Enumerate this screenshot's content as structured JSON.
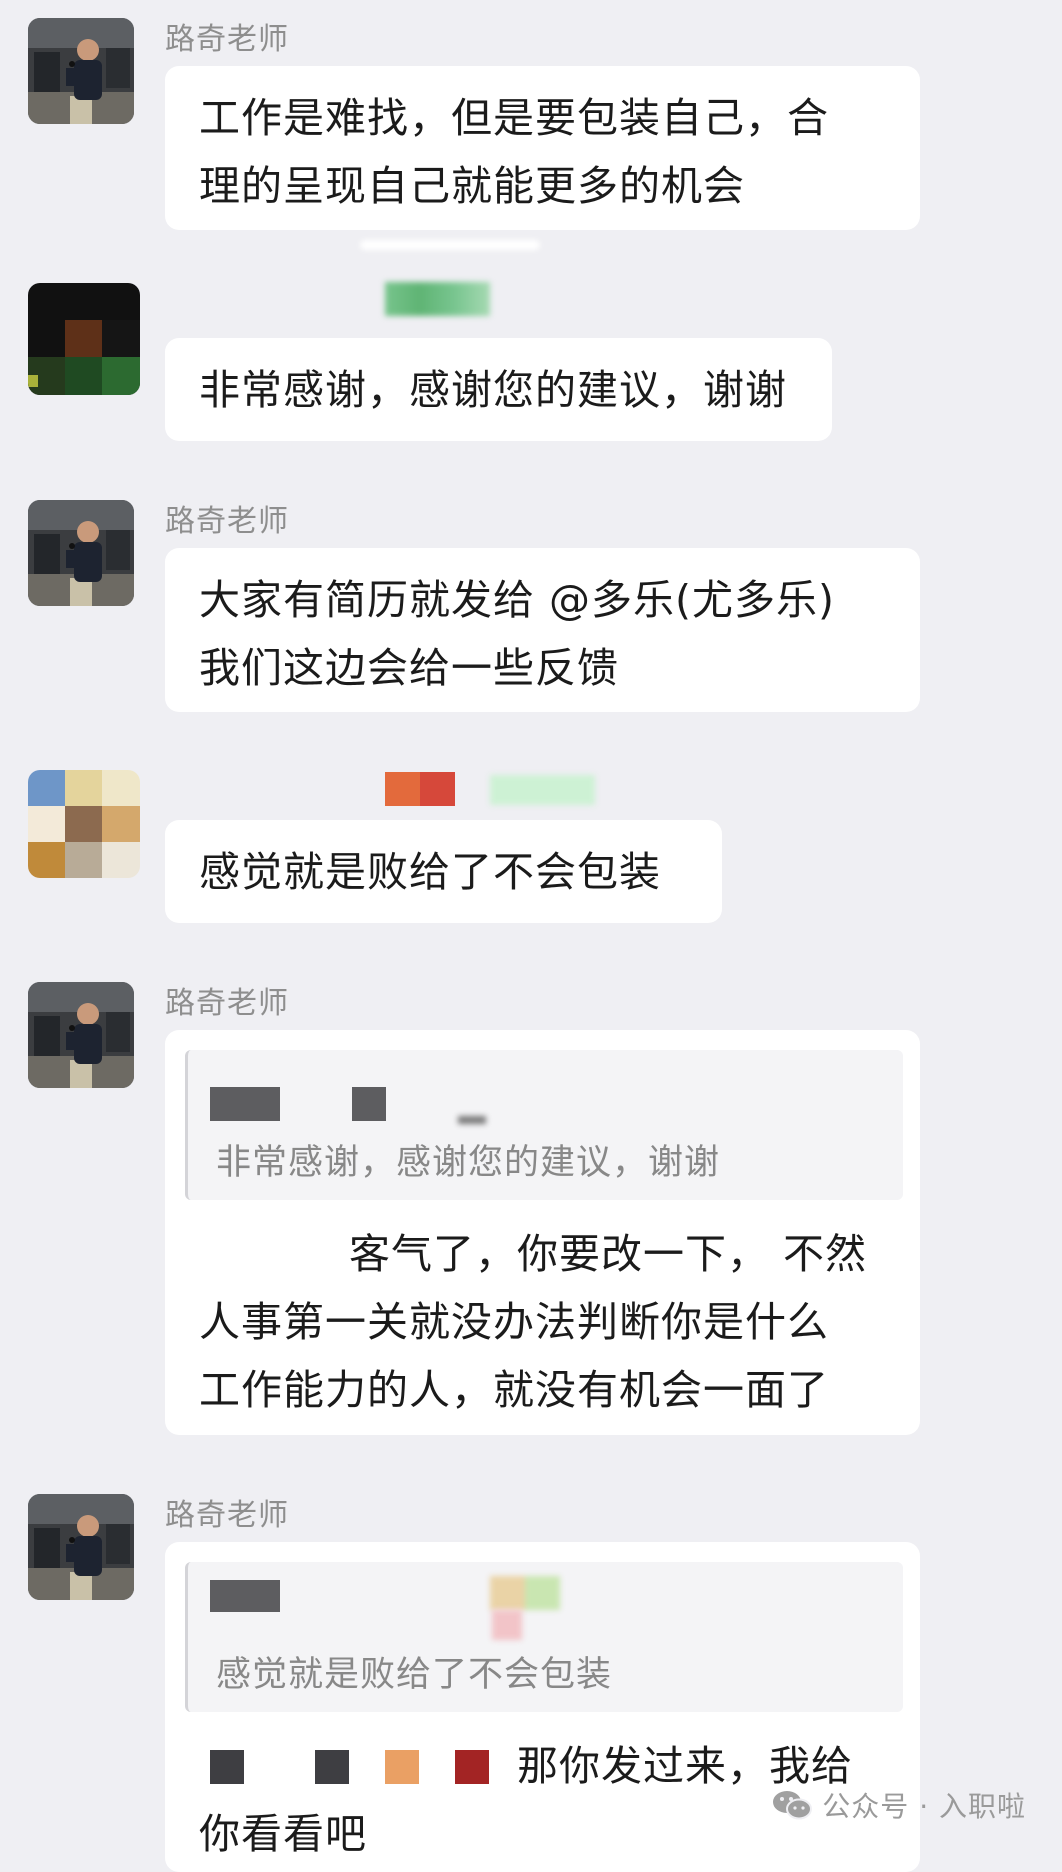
{
  "messages": [
    {
      "sender": "路奇老师",
      "avatar": "teacher-avatar",
      "lines": [
        "工作是难找，但是要包装自己，合",
        "理的呈现自己就能更多的机会"
      ]
    },
    {
      "sender": "",
      "avatar": "pixelated-avatar-dark",
      "lines": [
        "非常感谢，感谢您的建议，谢谢"
      ]
    },
    {
      "sender": "路奇老师",
      "avatar": "teacher-avatar",
      "lines": [
        "大家有简历就发给 @多乐(尤多乐)",
        "我们这边会给一些反馈"
      ]
    },
    {
      "sender": "",
      "avatar": "pixelated-avatar-colorful",
      "lines": [
        "感觉就是败给了不会包装"
      ]
    },
    {
      "sender": "路奇老师",
      "avatar": "teacher-avatar",
      "quote": "非常感谢，感谢您的建议，谢谢",
      "lines": [
        "客气了，你要改一下， 不然",
        "人事第一关就没办法判断你是什么",
        "工作能力的人，就没有机会一面了"
      ]
    },
    {
      "sender": "路奇老师",
      "avatar": "teacher-avatar",
      "quote": "感觉就是败给了不会包装",
      "lines": [
        "那你发过来，我给",
        "你看看吧"
      ]
    }
  ],
  "watermark": {
    "icon": "wechat-icon",
    "text": "公众号 · 入职啦"
  },
  "colors": {
    "background": "#efeff3",
    "bubble": "#ffffff",
    "name": "#8e8e8e",
    "quote_text": "#888888"
  }
}
